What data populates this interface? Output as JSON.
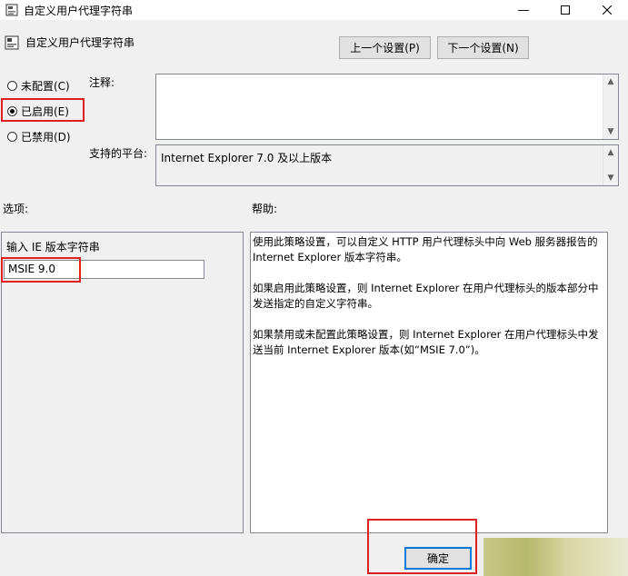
{
  "window": {
    "title": "自定义用户代理字符串",
    "controls": [
      "minimize",
      "maximize",
      "close"
    ]
  },
  "header": {
    "title": "自定义用户代理字符串",
    "prev_button": "上一个设置(P)",
    "next_button": "下一个设置(N)"
  },
  "state": {
    "options": [
      {
        "label": "未配置(C)",
        "selected": false
      },
      {
        "label": "已启用(E)",
        "selected": true
      },
      {
        "label": "已禁用(D)",
        "selected": false
      }
    ]
  },
  "comment": {
    "label": "注释:",
    "value": ""
  },
  "platform": {
    "label": "支持的平台:",
    "value": "Internet Explorer 7.0 及以上版本"
  },
  "options_panel": {
    "heading": "选项:",
    "field_label": "输入 IE 版本字符串",
    "field_value": "MSIE 9.0"
  },
  "help_panel": {
    "heading": "帮助:",
    "paragraphs": [
      "使用此策略设置，可以自定义 HTTP 用户代理标头中向 Web 服务器报告的 Internet Explorer 版本字符串。",
      "如果启用此策略设置，则 Internet Explorer 在用户代理标头的版本部分中发送指定的自定义字符串。",
      "如果禁用或未配置此策略设置，则 Internet Explorer 在用户代理标头中发送当前 Internet Explorer 版本(如“MSIE 7.0”)。"
    ]
  },
  "footer": {
    "ok_button": "确定"
  },
  "colors": {
    "highlight_border": "#e02020",
    "focused_button_border": "#0078d7"
  }
}
